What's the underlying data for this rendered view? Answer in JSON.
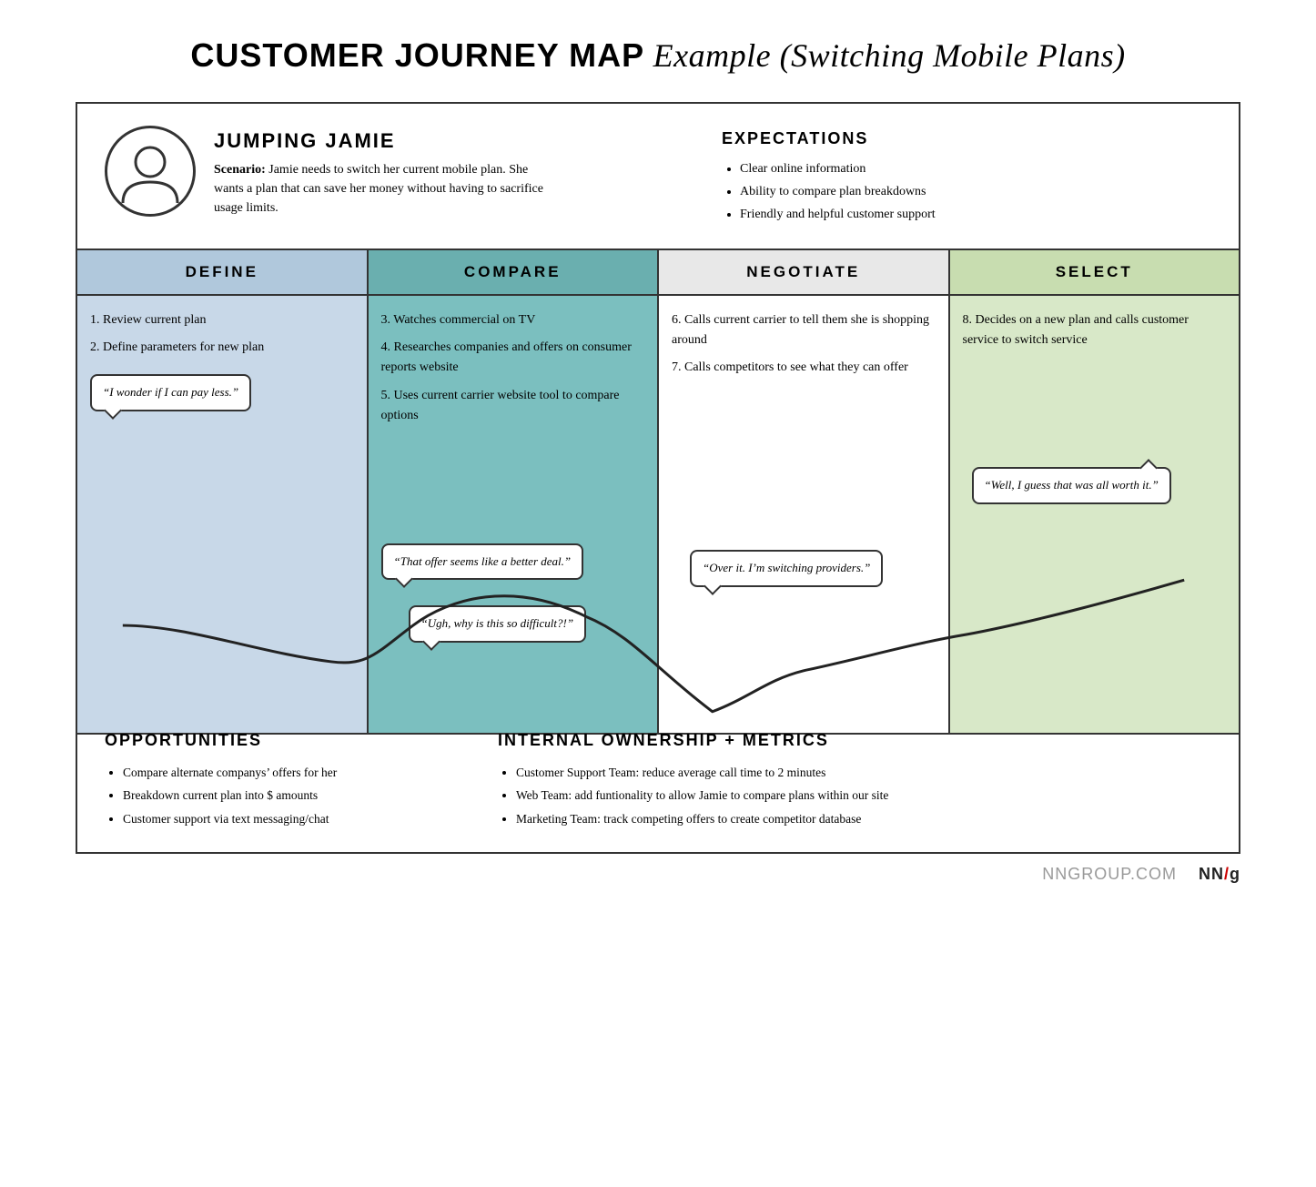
{
  "title": {
    "bold": "CUSTOMER JOURNEY MAP",
    "italic": "Example (Switching Mobile Plans)"
  },
  "persona": {
    "name": "JUMPING JAMIE",
    "scenario_label": "Scenario:",
    "scenario_text": "Jamie needs to switch her current mobile plan. She wants a plan that can save her money without having to sacrifice usage limits."
  },
  "expectations": {
    "title": "EXPECTATIONS",
    "items": [
      "Clear online information",
      "Ability to compare plan breakdowns",
      "Friendly and helpful customer support"
    ]
  },
  "phases": [
    {
      "id": "define",
      "label": "DEFINE",
      "steps": [
        "1. Review current plan",
        "2. Define parameters for new plan"
      ],
      "bubble": "“I wonder if I can pay less.”",
      "bubble_secondary": ""
    },
    {
      "id": "compare",
      "label": "COMPARE",
      "steps": [
        "3. Watches commercial on TV",
        "4. Researches companies and offers on consumer reports website",
        "5. Uses current carrier website tool to compare options"
      ],
      "bubble": "“That offer seems like a better deal.”",
      "bubble_secondary": "“Ugh, why is this so difficult?!”"
    },
    {
      "id": "negotiate",
      "label": "NEGOTIATE",
      "steps": [
        "6. Calls current carrier to tell them she is shopping around",
        "7. Calls competitors to see what they can offer"
      ],
      "bubble": "“Over it. I’m switching providers.”",
      "bubble_secondary": ""
    },
    {
      "id": "select",
      "label": "SELECT",
      "steps": [
        "8. Decides on a new plan and calls customer service to switch service"
      ],
      "bubble": "“Well, I guess that was all worth it.”",
      "bubble_secondary": ""
    }
  ],
  "opportunities": {
    "title": "OPPORTUNITIES",
    "items": [
      "Compare alternate companys’ offers for her",
      "Breakdown current plan into $ amounts",
      "Customer support via text messaging/chat"
    ]
  },
  "internal_metrics": {
    "title": "INTERNAL OWNERSHIP + METRICS",
    "items": [
      "Customer Support Team: reduce average call time to 2 minutes",
      "Web Team: add funtionality to allow Jamie to compare plans within our site",
      "Marketing Team: track competing offers to create competitor database"
    ]
  },
  "footer": {
    "text": "NNGROUP.COM",
    "logo_nn": "NN",
    "logo_slash": "/",
    "logo_g": "g"
  }
}
